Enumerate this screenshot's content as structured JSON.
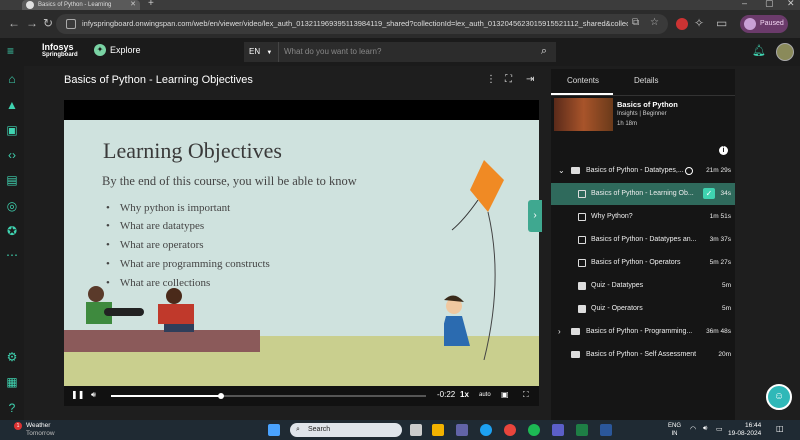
{
  "browser": {
    "tab_title": "Basics of Python - Learning",
    "url": "infyspringboard.onwingspan.com/web/en/viewer/video/lex_auth_013211969395113984119_shared?collectionId=lex_auth_0132045623015915521112_shared&collectio...",
    "profile_label": "Paused"
  },
  "header": {
    "logo_line1": "Infosys",
    "logo_line2": "Springboard",
    "explore_label": "Explore",
    "lang": "EN",
    "search_placeholder": "What do you want to learn?"
  },
  "main": {
    "title": "Basics of Python - Learning Objectives",
    "slide": {
      "heading": "Learning Objectives",
      "subheading": "By the end of this course, you will be able to know",
      "bullets": [
        "Why python is important",
        "What are datatypes",
        "What are operators",
        "What are programming constructs",
        "What are collections"
      ]
    },
    "player": {
      "time_remaining": "-0:22",
      "speed": "1x",
      "quality": "auto",
      "progress": 0.35
    }
  },
  "panel": {
    "tab_contents": "Contents",
    "tab_details": "Details",
    "course_name": "Basics of Python",
    "course_meta": "Insights | Beginner",
    "course_length": "1h 18m",
    "sections": [
      {
        "label": "Basics of Python - Datatypes,...",
        "duration": "21m 29s"
      },
      {
        "label": "Basics of Python - Programming...",
        "duration": "36m 48s"
      },
      {
        "label": "Basics of Python - Self Assessment",
        "duration": "20m"
      }
    ],
    "items": [
      {
        "label": "Basics of Python - Learning Ob...",
        "duration": "34s"
      },
      {
        "label": "Why Python?",
        "duration": "1m 51s"
      },
      {
        "label": "Basics of Python - Datatypes an...",
        "duration": "3m 37s"
      },
      {
        "label": "Basics of Python - Operators",
        "duration": "5m 27s"
      },
      {
        "label": "Quiz - Datatypes",
        "duration": "5m"
      },
      {
        "label": "Quiz - Operators",
        "duration": "5m"
      }
    ]
  },
  "taskbar": {
    "weather_title": "Weather",
    "weather_sub": "Tomorrow",
    "weather_badge": "1",
    "search_label": "Search",
    "lang_line1": "ENG",
    "lang_line2": "IN",
    "time": "16:44",
    "date": "19-08-2024"
  }
}
